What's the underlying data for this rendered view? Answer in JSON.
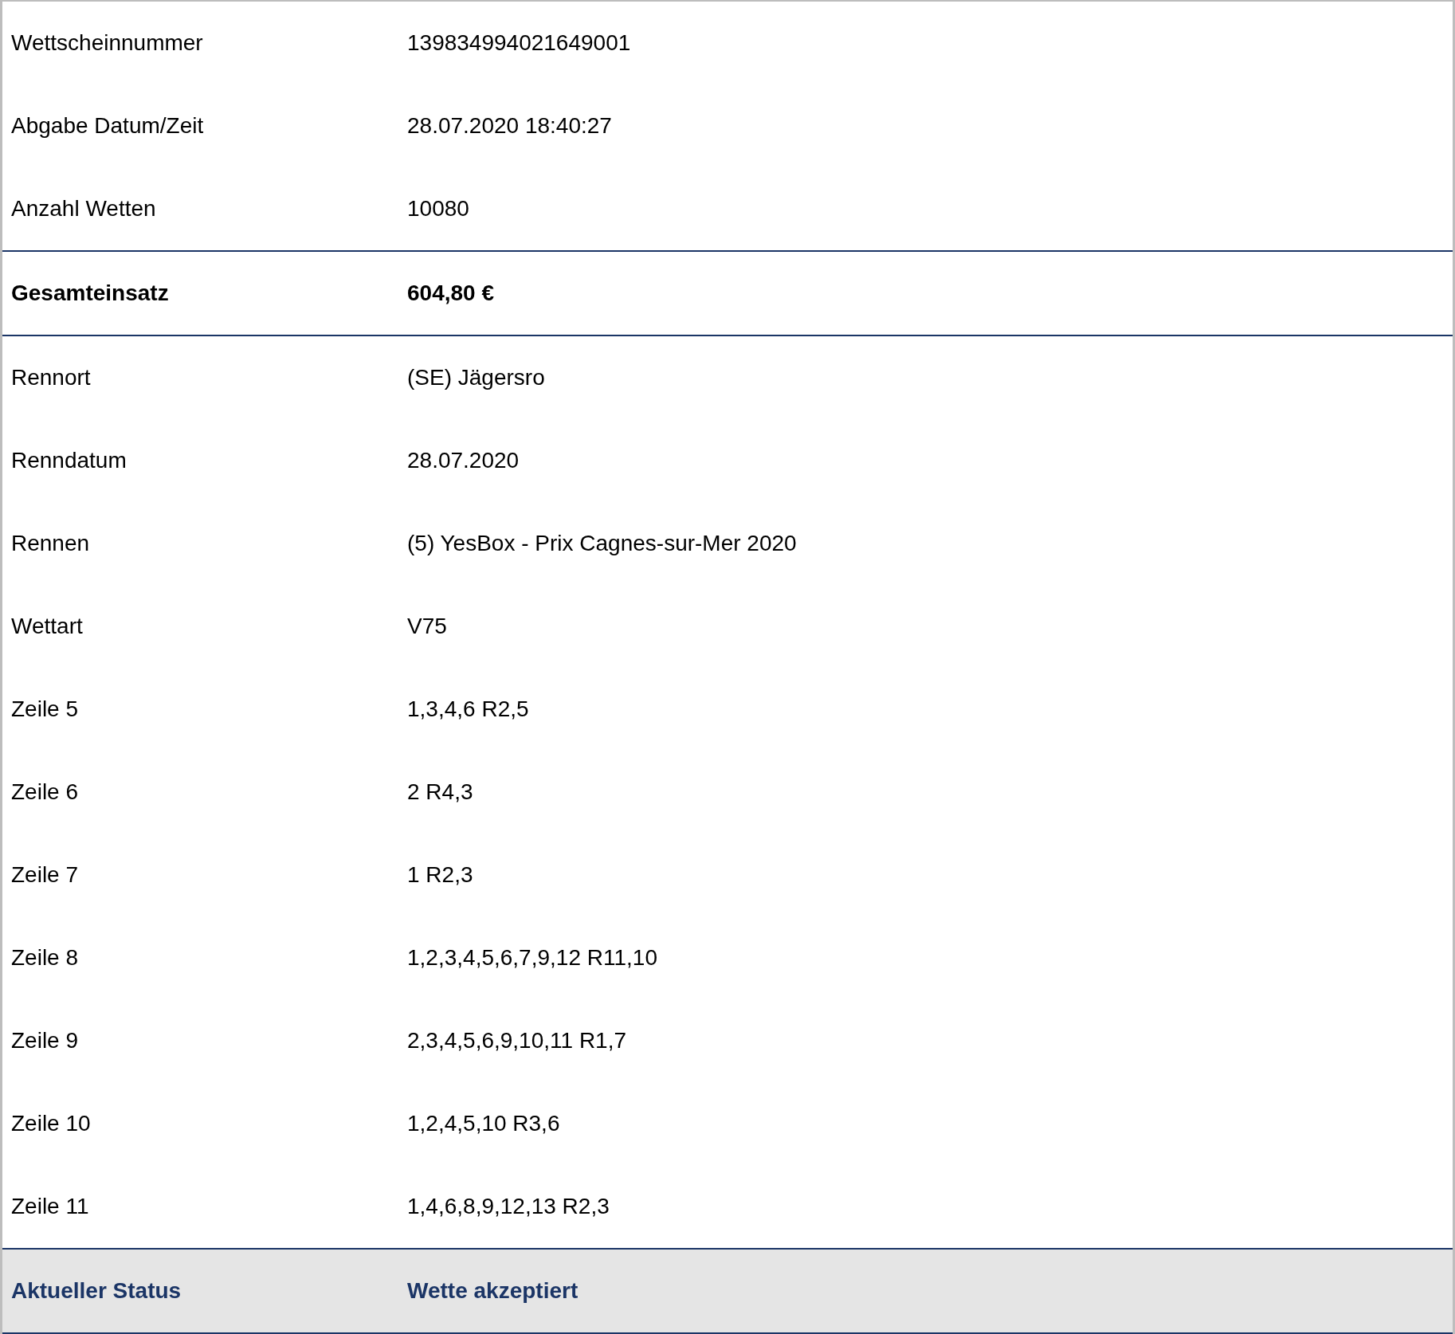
{
  "rows": [
    {
      "kind": "plain",
      "label": "Wettscheinnummer",
      "value": "139834994021649001"
    },
    {
      "kind": "plain",
      "label": "Abgabe Datum/Zeit",
      "value": "28.07.2020 18:40:27"
    },
    {
      "kind": "plain",
      "label": "Anzahl Wetten",
      "value": "10080"
    },
    {
      "kind": "total",
      "label": "Gesamteinsatz",
      "value": "604,80 €"
    },
    {
      "kind": "plain",
      "label": "Rennort",
      "value": "(SE) Jägersro"
    },
    {
      "kind": "plain",
      "label": "Renndatum",
      "value": "28.07.2020"
    },
    {
      "kind": "plain",
      "label": "Rennen",
      "value": "(5) YesBox - Prix Cagnes-sur-Mer 2020"
    },
    {
      "kind": "plain",
      "label": "Wettart",
      "value": "V75"
    },
    {
      "kind": "plain",
      "label": "Zeile 5",
      "value": "1,3,4,6 R2,5"
    },
    {
      "kind": "plain",
      "label": "Zeile 6",
      "value": "2 R4,3"
    },
    {
      "kind": "plain",
      "label": "Zeile 7",
      "value": "1 R2,3"
    },
    {
      "kind": "plain",
      "label": "Zeile 8",
      "value": "1,2,3,4,5,6,7,9,12 R11,10"
    },
    {
      "kind": "plain",
      "label": "Zeile 9",
      "value": "2,3,4,5,6,9,10,11 R1,7"
    },
    {
      "kind": "plain",
      "label": "Zeile 10",
      "value": "1,2,4,5,10 R3,6"
    },
    {
      "kind": "plain",
      "label": "Zeile 11",
      "value": "1,4,6,8,9,12,13 R2,3"
    },
    {
      "kind": "status",
      "label": "Aktueller Status",
      "value": "Wette akzeptiert"
    }
  ]
}
